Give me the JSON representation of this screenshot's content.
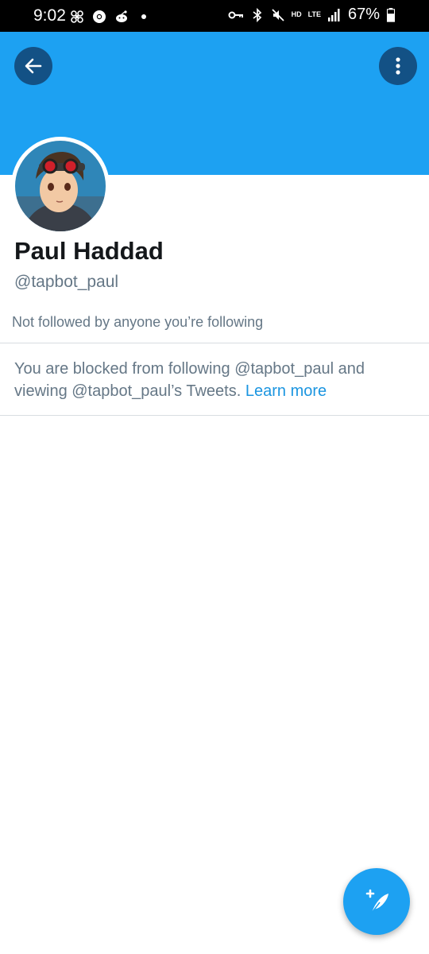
{
  "status_bar": {
    "time": "9:02",
    "network": "LTE",
    "hd": "HD",
    "battery": "67%",
    "icons": [
      "pinwheel-icon",
      "chrome-icon",
      "reddit-icon",
      "dot-icon",
      "vpn-key-icon",
      "bluetooth-icon",
      "mute-icon",
      "signal-icon",
      "battery-icon"
    ]
  },
  "header": {
    "color": "#1da1f2",
    "back_icon": "arrow-left-icon",
    "more_icon": "more-vertical-icon"
  },
  "profile": {
    "name": "Paul Haddad",
    "handle": "@tapbot_paul",
    "followed_note": "Not followed by anyone you’re following"
  },
  "blocked": {
    "message": "You are blocked from following @tapbot_paul and viewing @tapbot_paul’s Tweets.",
    "link": "Learn more"
  },
  "fab": {
    "icon": "compose-tweet-icon",
    "color": "#1da1f2"
  }
}
